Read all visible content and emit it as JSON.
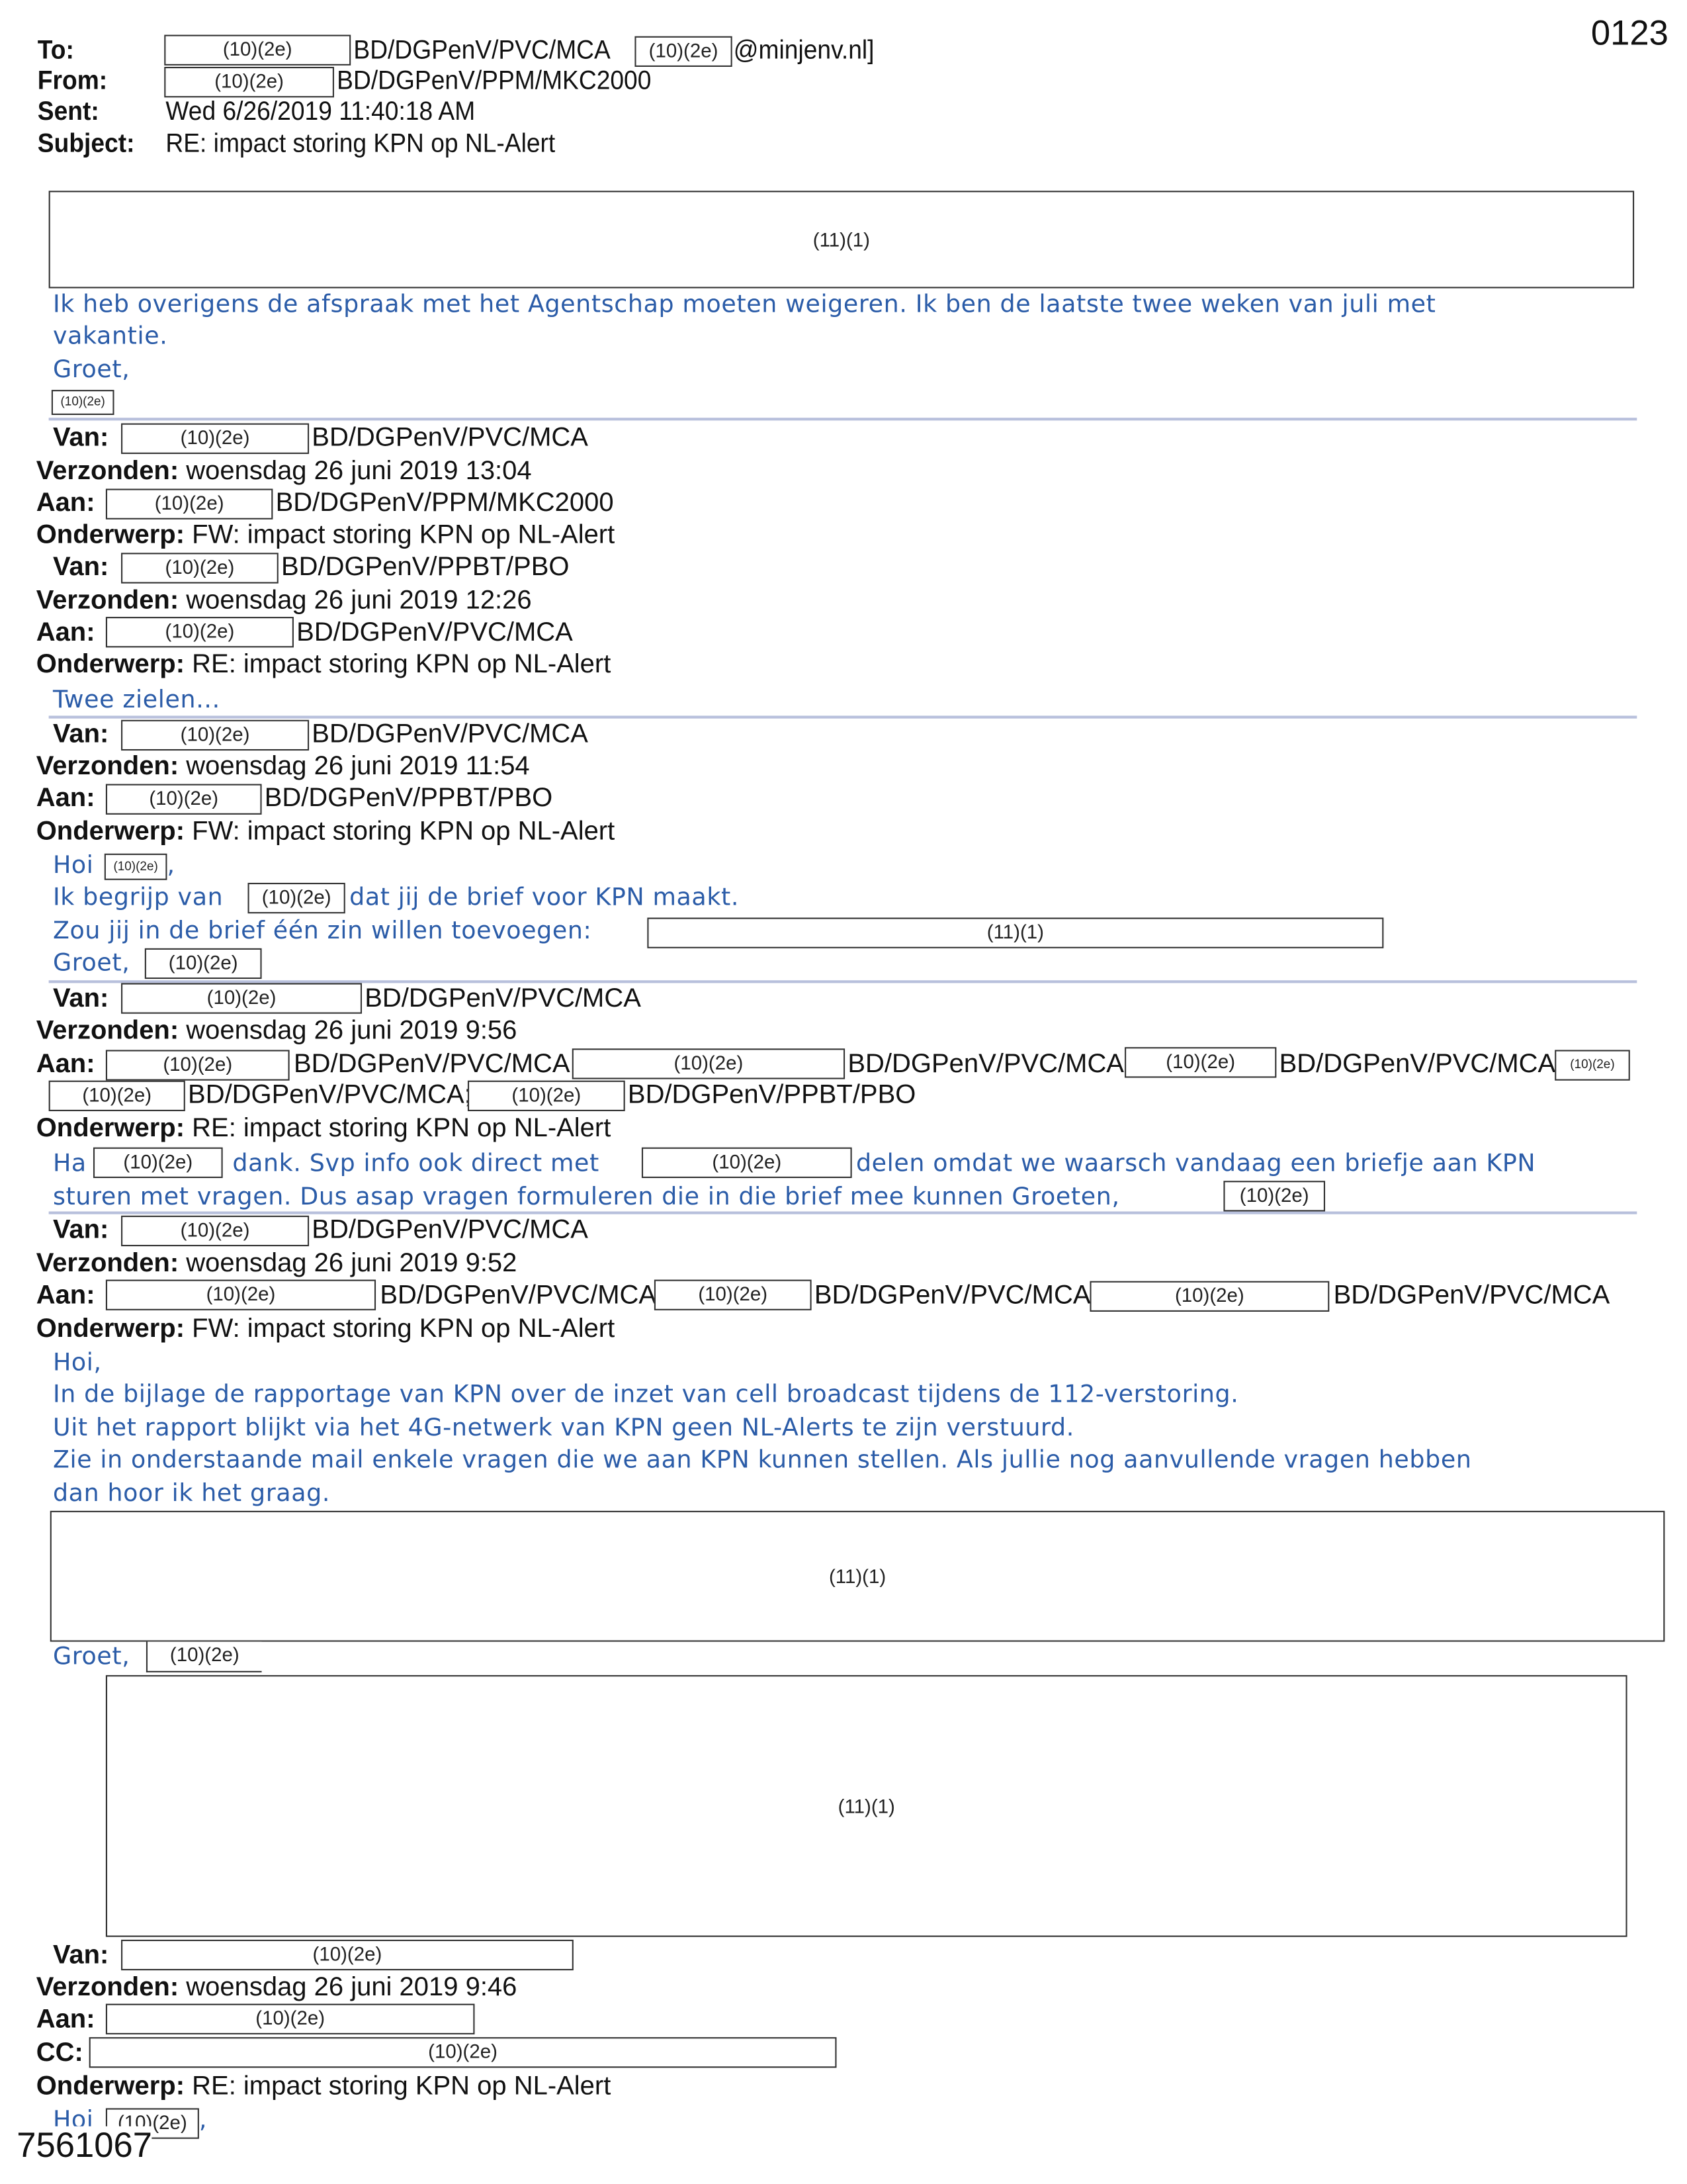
{
  "page_number": "0123",
  "document_id": "7561067",
  "redaction": {
    "personal": "(10)(2e)",
    "policy": "(11)(1)"
  },
  "header": {
    "to_label": "To:",
    "to_org": "BD/DGPenV/PVC/MCA",
    "to_domain": "@minjenv.nl]",
    "from_label": "From:",
    "from_org": "BD/DGPenV/PPM/MKC2000",
    "sent_label": "Sent:",
    "sent_value": "Wed 6/26/2019 11:40:18 AM",
    "subject_label": "Subject:",
    "subject_value": "RE: impact storing KPN op NL-Alert"
  },
  "labels": {
    "van": "Van:",
    "verzonden": "Verzonden:",
    "aan": "Aan:",
    "cc": "CC:",
    "onderwerp": "Onderwerp:"
  },
  "orgs": {
    "pvc": "BD/DGPenV/PVC/MCA",
    "pvc_semi": "BD/DGPenV/PVC/MCA;",
    "ppm": "BD/DGPenV/PPM/MKC2000",
    "ppbt": "BD/DGPenV/PPBT/PBO"
  },
  "subjects": {
    "fw": "FW: impact storing KPN op NL-Alert",
    "re": "RE: impact storing KPN op NL-Alert"
  },
  "body0": {
    "line1": "Ik heb overigens de afspraak met het Agentschap moeten weigeren. Ik ben de laatste twee weken van juli met",
    "line2": "vakantie.",
    "greeting": "Groet,"
  },
  "messages": [
    {
      "sent": "woensdag 26 juni 2019 13:04"
    },
    {
      "sent": "woensdag 26 juni 2019 12:26",
      "body": "Twee zielen..."
    },
    {
      "sent": "woensdag 26 juni 2019 11:54",
      "hoi": "Hoi",
      "comma": ",",
      "l2a": "Ik begrijp van",
      "l2b": "dat jij de brief voor KPN maakt.",
      "l3": "Zou jij in de brief één zin willen toevoegen:",
      "groet": "Groet,"
    },
    {
      "sent": "woensdag 26 juni 2019 9:56",
      "l1a": "Ha",
      "l1b": "dank. Svp info ook direct met",
      "l1c": "delen omdat we waarsch vandaag een briefje aan KPN",
      "l2": "sturen met vragen. Dus asap vragen formuleren die in die brief mee kunnen Groeten,"
    },
    {
      "sent": "woensdag 26 juni 2019 9:52",
      "l1": "Hoi,",
      "l2": "In de bijlage de rapportage van KPN over de inzet van cell broadcast tijdens de 112-verstoring.",
      "l3": "Uit het rapport blijkt via het 4G-netwerk van KPN geen NL-Alerts te zijn verstuurd.",
      "l4": "Zie in onderstaande mail enkele vragen die we aan KPN kunnen stellen. Als jullie nog aanvullende vragen hebben",
      "l5": "dan hoor ik het graag.",
      "groet": "Groet,"
    },
    {
      "sent": "woensdag 26 juni 2019 9:46",
      "hoi": "Hoi",
      "comma": ","
    }
  ]
}
